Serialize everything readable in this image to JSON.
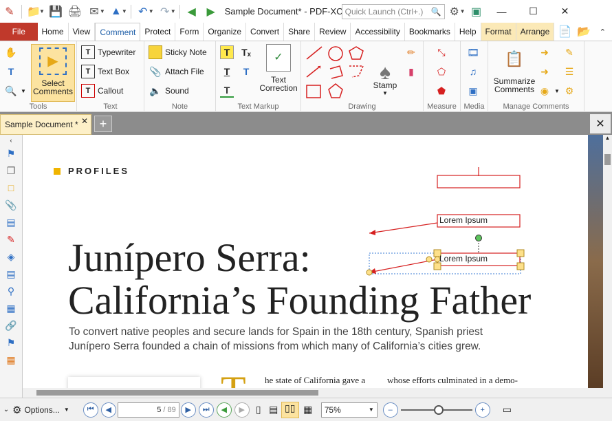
{
  "window": {
    "title": "Sample Document* - PDF-XCh...",
    "quick_launch_placeholder": "Quick Launch (Ctrl+.)"
  },
  "tabs": {
    "file": "File",
    "items": [
      "Home",
      "View",
      "Comment",
      "Protect",
      "Form",
      "Organize",
      "Convert",
      "Share",
      "Review",
      "Accessibility",
      "Bookmarks",
      "Help",
      "Format",
      "Arrange"
    ]
  },
  "ribbon": {
    "tools": {
      "label": "Tools",
      "select_comments": "Select Comments"
    },
    "text": {
      "label": "Text",
      "typewriter": "Typewriter",
      "text_box": "Text Box",
      "callout": "Callout"
    },
    "note": {
      "label": "Note",
      "sticky_note": "Sticky Note",
      "attach_file": "Attach File",
      "sound": "Sound"
    },
    "text_markup": {
      "label": "Text Markup",
      "text_correction": "Text Correction"
    },
    "drawing": {
      "label": "Drawing",
      "stamp": "Stamp"
    },
    "measure": {
      "label": "Measure"
    },
    "media": {
      "label": "Media"
    },
    "manage": {
      "label": "Manage Comments",
      "summarize": "Summarize Comments"
    }
  },
  "document": {
    "tab_label": "Sample Document *",
    "section": "PROFILES",
    "title_line1": "Junípero Serra:",
    "title_line2": "California’s Founding Father",
    "subtitle": "To convert native peoples and secure lands for Spain in the 18th century, Spanish priest Junípero Serra founded a chain of missions from which many of California’s cities grew.",
    "drop_cap": "T",
    "body_start": "he state of California gave a",
    "body_right": "whose efforts culminated in a demo-",
    "callout1_text": "Lorem Ipsum",
    "callout2_text": "Lorem Ipsum"
  },
  "status": {
    "options": "Options...",
    "page_current": "5",
    "page_total": "89",
    "zoom": "75%"
  },
  "colors": {
    "accent": "#1f5fa8",
    "file_tab": "#c0392b",
    "annotation": "#d62020",
    "section_marker": "#f0b400"
  }
}
